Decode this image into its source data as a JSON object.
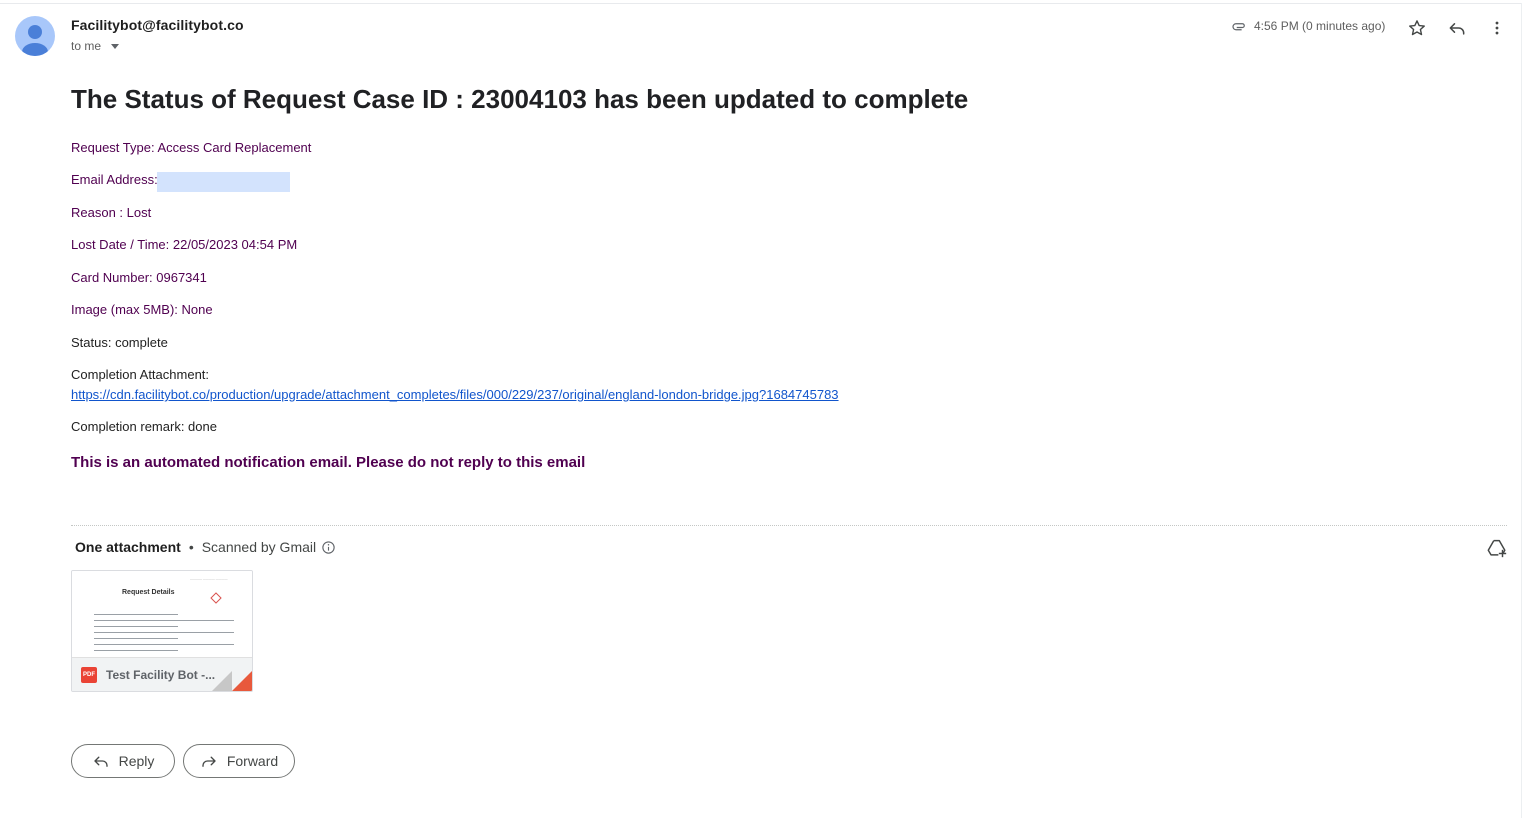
{
  "header": {
    "sender": "Facilitybot@facilitybot.co",
    "to_label": "to me",
    "time": "4:56 PM (0 minutes ago)",
    "icons": [
      "paperclip-icon",
      "star-icon",
      "reply-icon",
      "more-vert-icon",
      "chevron-down-icon",
      "avatar-person-icon"
    ]
  },
  "email": {
    "subject": "The Status of Request Case ID : 23004103 has been updated to complete",
    "request_type": "Request Type: Access Card Replacement",
    "email_address_label": "Email Address:",
    "reason": "Reason : Lost",
    "lost_datetime": "Lost Date / Time: 22/05/2023 04:54 PM",
    "card_number": "Card Number: 0967341",
    "image": "Image (max 5MB): None",
    "status": "Status: complete",
    "completion_attachment_label": "Completion Attachment:",
    "completion_attachment_url": "https://cdn.facilitybot.co/production/upgrade/attachment_completes/files/000/229/237/original/england-london-bridge.jpg?1684745783",
    "completion_remark": "Completion remark: done",
    "notice": "This is an automated notification email. Please do not reply to this email"
  },
  "attachments": {
    "count_label": "One attachment",
    "separator": "•",
    "scanned_label": "Scanned by Gmail",
    "items": [
      {
        "filename": "Test Facility Bot -...",
        "file_type": "PDF",
        "preview_title": "Request Details"
      }
    ]
  },
  "actions": {
    "reply_label": "Reply",
    "forward_label": "Forward"
  },
  "colors": {
    "purple_text": "#500050",
    "link": "#1155cc",
    "avatar_bg": "#a8c7fa",
    "pdf_red": "#ea4335"
  }
}
